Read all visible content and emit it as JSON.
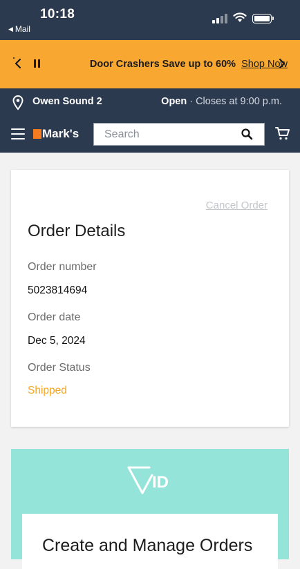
{
  "status_bar": {
    "time": "10:18",
    "back_app": "Mail"
  },
  "promo_banner": {
    "message": "Door Crashers Save up to 60%",
    "link": "Shop Now",
    "background": "#f8a831"
  },
  "store_bar": {
    "store_name": "Owen Sound 2",
    "open_label": "Open",
    "separator": "·",
    "closes_text": "Closes at 9:00 p.m."
  },
  "nav": {
    "brand": "Mark's",
    "search_placeholder": "Search",
    "accent": "#f47c20"
  },
  "order_details": {
    "cancel_link": "Cancel Order",
    "title": "Order Details",
    "order_number_label": "Order number",
    "order_number": "5023814694",
    "order_date_label": "Order date",
    "order_date": "Dec 5, 2024",
    "order_status_label": "Order Status",
    "order_status": "Shipped",
    "status_color": "#f5a623"
  },
  "promo_panel": {
    "logo_text": "ID",
    "heading": "Create and Manage Orders",
    "background": "#94e4da"
  }
}
